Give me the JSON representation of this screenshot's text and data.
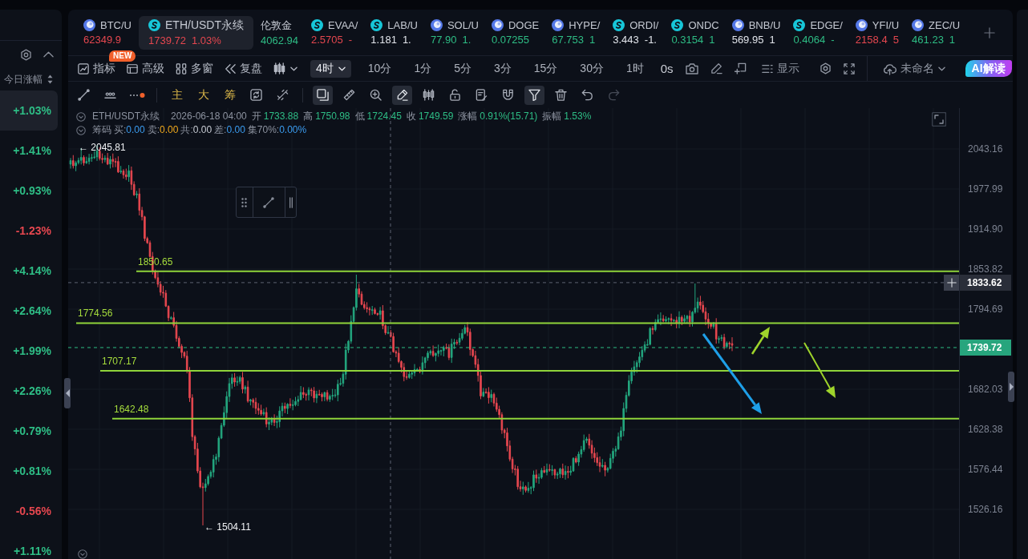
{
  "ticker_tabs": [
    {
      "kind": "globe",
      "symbol": "BTC/U",
      "price": "62349.9",
      "color": "#e5474f",
      "selected": false
    },
    {
      "kind": "swirl",
      "symbol": "ETH/USDT永续",
      "price": "1739.72",
      "change": "1.03%",
      "color": "#e5474f",
      "selected": true
    },
    {
      "kind": "plain",
      "symbol": "伦敦金",
      "price": "4062.94",
      "color": "#2ebd85",
      "selected": false
    },
    {
      "kind": "swirl",
      "symbol": "EVAA/",
      "price": "2.5705",
      "change": "-",
      "color": "#e5474f",
      "selected": false
    },
    {
      "kind": "swirl",
      "symbol": "LAB/U",
      "price": "1.181",
      "change": "1.",
      "color": "#e1e4ea",
      "selected": false
    },
    {
      "kind": "globe",
      "symbol": "SOL/U",
      "price": "77.90",
      "change": "1.",
      "color": "#2ebd85",
      "selected": false
    },
    {
      "kind": "globe",
      "symbol": "DOGE",
      "price": "0.07255",
      "color": "#2ebd85",
      "selected": false
    },
    {
      "kind": "globe",
      "symbol": "HYPE/",
      "price": "67.753",
      "change": "1",
      "color": "#2ebd85",
      "selected": false
    },
    {
      "kind": "swirl",
      "symbol": "ORDI/",
      "price": "3.443",
      "change": "-1.",
      "color": "#e1e4ea",
      "selected": false
    },
    {
      "kind": "swirl",
      "symbol": "ONDC",
      "price": "0.3154",
      "change": "1",
      "color": "#2ebd85",
      "selected": false
    },
    {
      "kind": "globe",
      "symbol": "BNB/U",
      "price": "569.95",
      "change": "1",
      "color": "#e1e4ea",
      "selected": false
    },
    {
      "kind": "swirl",
      "symbol": "EDGE/",
      "price": "0.4064",
      "change": "-",
      "color": "#2ebd85",
      "selected": false
    },
    {
      "kind": "globe",
      "symbol": "YFI/U",
      "price": "2158.4",
      "change": "5",
      "color": "#e5474f",
      "selected": false
    },
    {
      "kind": "globe",
      "symbol": "ZEC/U",
      "price": "461.23",
      "change": "1",
      "color": "#2ebd85",
      "selected": false
    }
  ],
  "watchlist": {
    "sort_label": "今日涨幅",
    "items": [
      {
        "change": "+1.03%",
        "color": "#2ebd85",
        "selected": true
      },
      {
        "change": "+1.41%",
        "color": "#2ebd85",
        "selected": false
      },
      {
        "change": "+0.93%",
        "color": "#2ebd85",
        "selected": false
      },
      {
        "change": "-1.23%",
        "color": "#e5474f",
        "selected": false
      },
      {
        "change": "+4.14%",
        "color": "#2ebd85",
        "selected": false
      },
      {
        "change": "+2.64%",
        "color": "#2ebd85",
        "selected": false
      },
      {
        "change": "+1.99%",
        "color": "#2ebd85",
        "selected": false
      },
      {
        "change": "+2.26%",
        "color": "#2ebd85",
        "selected": false
      },
      {
        "change": "+0.79%",
        "color": "#2ebd85",
        "selected": false
      },
      {
        "change": "+0.81%",
        "color": "#2ebd85",
        "selected": false
      },
      {
        "change": "-0.56%",
        "color": "#e5474f",
        "selected": false
      },
      {
        "change": "+1.11%",
        "color": "#2ebd85",
        "selected": false
      }
    ]
  },
  "toolbar": {
    "tools": [
      {
        "label": "指标",
        "badge": "NEW"
      },
      {
        "label": "高级"
      },
      {
        "label": "多窗"
      },
      {
        "label": "复盘"
      }
    ],
    "intervals": [
      {
        "label": "4时",
        "selected": true
      },
      {
        "label": "10分",
        "selected": false
      },
      {
        "label": "1分",
        "selected": false
      },
      {
        "label": "5分",
        "selected": false
      },
      {
        "label": "3分",
        "selected": false
      },
      {
        "label": "15分",
        "selected": false
      },
      {
        "label": "30分",
        "selected": false
      },
      {
        "label": "1时",
        "selected": false
      }
    ],
    "timer": "0s",
    "display_label": "显示",
    "layout_name": "未命名",
    "ai_button": "AI解读"
  },
  "drawing_bar": {
    "toggles": [
      {
        "label": "主"
      },
      {
        "label": "大"
      },
      {
        "label": "筹"
      }
    ],
    "tools": [
      {
        "selected": true,
        "disabled": false
      },
      {
        "selected": false,
        "disabled": false
      },
      {
        "selected": false,
        "disabled": false
      },
      {
        "selected": true,
        "disabled": false
      },
      {
        "selected": false,
        "disabled": false
      },
      {
        "selected": false,
        "disabled": false
      },
      {
        "selected": false,
        "disabled": false
      },
      {
        "selected": false,
        "disabled": false
      },
      {
        "selected": true,
        "disabled": false
      },
      {
        "selected": false,
        "disabled": false
      },
      {
        "selected": false,
        "disabled": false
      },
      {
        "selected": false,
        "disabled": true
      }
    ]
  },
  "legend": {
    "symbol": "ETH/USDT永续",
    "time": "2026-06-18 04:00",
    "fields": [
      {
        "label": "开",
        "value": "1733.88"
      },
      {
        "label": "高",
        "value": "1750.98"
      },
      {
        "label": "低",
        "value": "1724.45"
      },
      {
        "label": "收",
        "value": "1749.59"
      },
      {
        "label": "涨幅",
        "value": "0.91%(15.71)"
      },
      {
        "label": "振幅",
        "value": "1.53%"
      }
    ]
  },
  "chips": {
    "title": "筹码",
    "fields": [
      {
        "label": "买:",
        "value": "0.00",
        "color": "#3b9cf0"
      },
      {
        "label": "卖:",
        "value": "0.00",
        "color": "#f0a81c"
      },
      {
        "label": "共:",
        "value": "0.00",
        "color": "#c8ccd4"
      },
      {
        "label": "差:",
        "value": "0.00",
        "color": "#3b9cf0"
      },
      {
        "label": "集70%:",
        "value": "0.00%",
        "color": "#3b9cf0"
      }
    ]
  },
  "chart": {
    "price_ticks": [
      "2043.16",
      "1977.99",
      "1914.90",
      "1853.82",
      "1794.69",
      "1682.03",
      "1628.38",
      "1576.44",
      "1526.16"
    ],
    "levels": [
      {
        "label": "1850.65"
      },
      {
        "label": "1774.56"
      },
      {
        "label": "1707.17"
      },
      {
        "label": "1642.48"
      }
    ],
    "extremes": [
      {
        "label": "← 2045.81"
      },
      {
        "label": "← 1504.11"
      }
    ],
    "crosshair_price": "1833.62",
    "last_price": "1739.72"
  }
}
